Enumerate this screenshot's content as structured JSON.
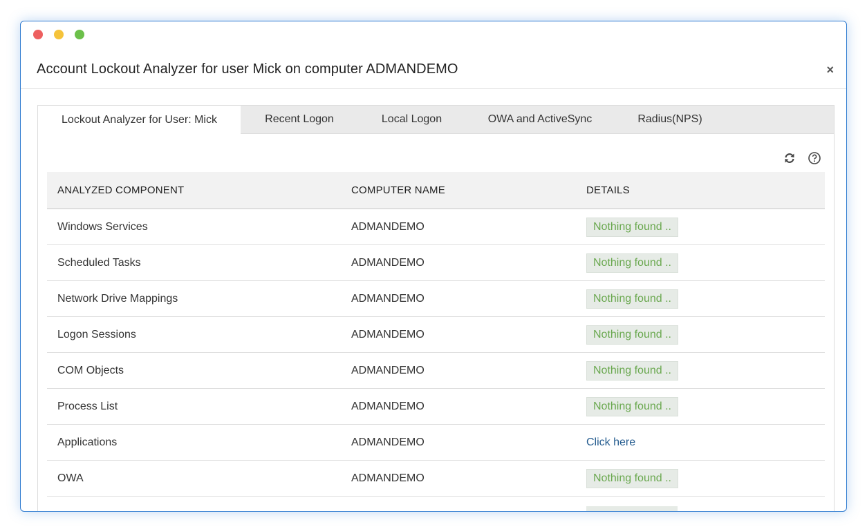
{
  "window": {
    "title": "Account Lockout Analyzer for user Mick on computer ADMANDEMO",
    "close_glyph": "×"
  },
  "tabs": [
    {
      "label": "Lockout Analyzer for User: Mick",
      "active": true
    },
    {
      "label": "Recent Logon",
      "active": false
    },
    {
      "label": "Local Logon",
      "active": false
    },
    {
      "label": "OWA and ActiveSync",
      "active": false
    },
    {
      "label": "Radius(NPS)",
      "active": false
    }
  ],
  "toolbar": {
    "refresh_icon": "refresh-icon",
    "help_icon": "help-icon"
  },
  "table": {
    "headers": [
      "ANALYZED COMPONENT",
      "COMPUTER NAME",
      "DETAILS"
    ],
    "rows": [
      {
        "component": "Windows Services",
        "computer": "ADMANDEMO",
        "details": "Nothing found ..",
        "details_type": "badge"
      },
      {
        "component": "Scheduled Tasks",
        "computer": "ADMANDEMO",
        "details": "Nothing found ..",
        "details_type": "badge"
      },
      {
        "component": "Network Drive Mappings",
        "computer": "ADMANDEMO",
        "details": "Nothing found ..",
        "details_type": "badge"
      },
      {
        "component": "Logon Sessions",
        "computer": "ADMANDEMO",
        "details": "Nothing found ..",
        "details_type": "badge"
      },
      {
        "component": "COM Objects",
        "computer": "ADMANDEMO",
        "details": "Nothing found ..",
        "details_type": "badge"
      },
      {
        "component": "Process List",
        "computer": "ADMANDEMO",
        "details": "Nothing found ..",
        "details_type": "badge"
      },
      {
        "component": "Applications",
        "computer": "ADMANDEMO",
        "details": "Click here",
        "details_type": "link"
      },
      {
        "component": "OWA",
        "computer": "ADMANDEMO",
        "details": "Nothing found ..",
        "details_type": "badge"
      }
    ]
  },
  "colors": {
    "accent_border": "#2f7bd0",
    "badge_text": "#6aa84f",
    "link": "#245c8f"
  }
}
